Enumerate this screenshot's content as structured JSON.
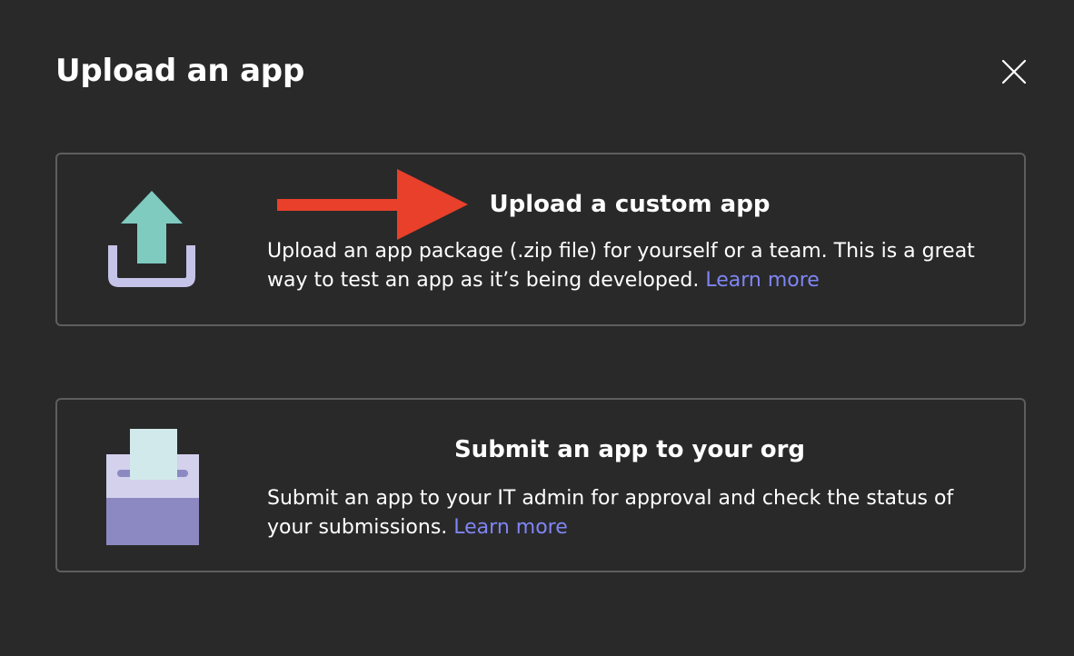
{
  "dialog": {
    "title": "Upload an app",
    "close_icon": "close-icon"
  },
  "options": [
    {
      "title": "Upload a custom app",
      "description": "Upload an app package (.zip file) for yourself or a team. This is a great way to test an app as it’s being developed.",
      "link": "Learn more",
      "icon": "upload-icon"
    },
    {
      "title": "Submit an app to your org",
      "description": "Submit an app to your IT admin for approval and check the status of your submissions.",
      "link": "Learn more",
      "icon": "submit-box-icon"
    }
  ],
  "annotation": {
    "icon": "red-arrow-icon",
    "color": "#e8402a"
  },
  "colors": {
    "background": "#292929",
    "card_border": "#5e5e5e",
    "link": "#7f85f5",
    "upload_arrow": "#7fcbc0",
    "upload_tray": "#c5c3e8",
    "box_top": "#d3d1ec",
    "box_bottom": "#8c89c2",
    "paper": "#d2e9ec"
  }
}
